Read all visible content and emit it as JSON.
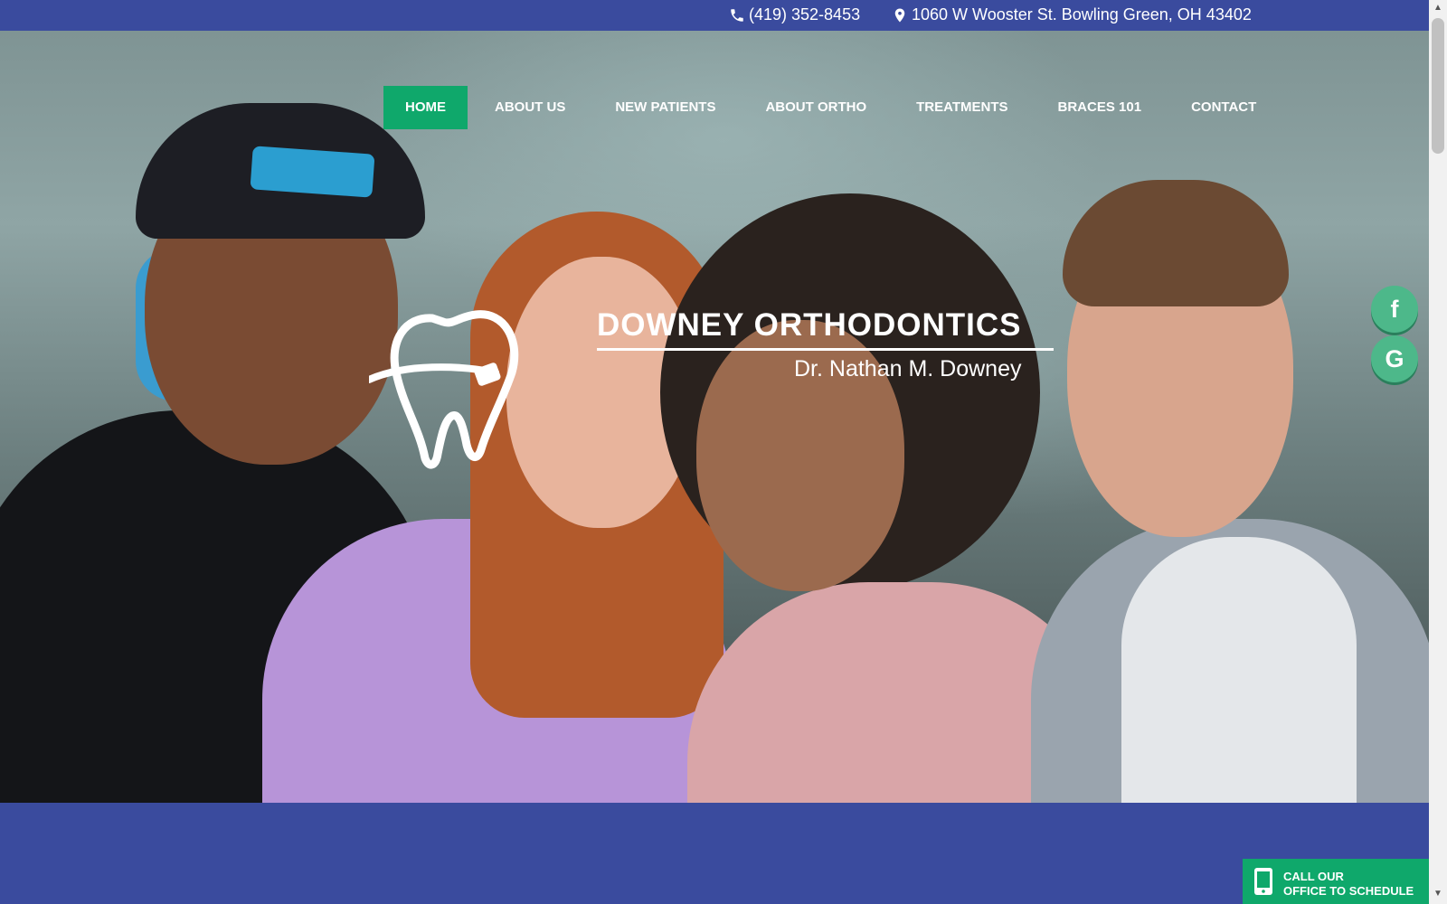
{
  "topbar": {
    "phone": "(419) 352-8453",
    "address": "1060 W Wooster St. Bowling Green, OH 43402",
    "phone_icon": "phone-icon",
    "address_icon": "map-marker-icon"
  },
  "nav": {
    "items": [
      {
        "label": "HOME",
        "active": true
      },
      {
        "label": "ABOUT US"
      },
      {
        "label": "NEW PATIENTS"
      },
      {
        "label": "ABOUT ORTHO"
      },
      {
        "label": "TREATMENTS"
      },
      {
        "label": "BRACES 101"
      },
      {
        "label": "CONTACT"
      }
    ]
  },
  "logo": {
    "name": "DOWNEY ORTHODONTICS",
    "doctor": "Dr. Nathan M. Downey",
    "icon": "tooth-logo-icon"
  },
  "social": {
    "facebook_glyph": "f",
    "google_glyph": "G"
  },
  "cta": {
    "line1": "CALL OUR",
    "line2": "OFFICE TO SCHEDULE",
    "icon": "mobile-phone-icon"
  },
  "colors": {
    "brand_blue": "#3a4b9e",
    "accent_green": "#0fa86b",
    "social_green": "#4db88a"
  }
}
